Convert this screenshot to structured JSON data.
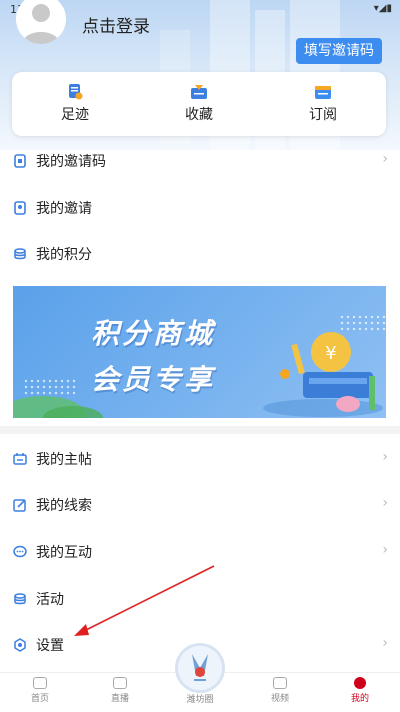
{
  "status_bar": {
    "time": "11:31"
  },
  "profile": {
    "login_text": "点击登录",
    "invite_button": "填写邀请码"
  },
  "quick_actions": [
    {
      "label": "足迹",
      "icon": "footprint-icon",
      "color": "#3d7fe0"
    },
    {
      "label": "收藏",
      "icon": "favorite-icon",
      "color": "#f0a030"
    },
    {
      "label": "订阅",
      "icon": "subscribe-icon",
      "color": "#3d8cf0"
    }
  ],
  "menu_group_1": [
    {
      "label": "我的邀请码",
      "icon": "invite-code-icon"
    },
    {
      "label": "我的邀请",
      "icon": "my-invite-icon"
    },
    {
      "label": "我的积分",
      "icon": "points-icon"
    }
  ],
  "banner": {
    "line1": "积分商城",
    "line2": "会员专享"
  },
  "menu_group_2": [
    {
      "label": "我的主帖",
      "icon": "posts-icon"
    },
    {
      "label": "我的线索",
      "icon": "clues-icon"
    },
    {
      "label": "我的互动",
      "icon": "interaction-icon"
    },
    {
      "label": "活动",
      "icon": "activity-icon"
    },
    {
      "label": "设置",
      "icon": "settings-icon"
    }
  ],
  "bottom_nav": [
    {
      "label": "首页",
      "icon": "home-icon"
    },
    {
      "label": "直播",
      "icon": "live-icon"
    },
    {
      "label": "潍坊圈",
      "icon": "circle-icon"
    },
    {
      "label": "视频",
      "icon": "video-icon"
    },
    {
      "label": "我的",
      "icon": "profile-icon",
      "active": true
    }
  ],
  "colors": {
    "accent": "#3d8cf0",
    "active_tab": "#d0021b",
    "arrow": "#e02020"
  }
}
